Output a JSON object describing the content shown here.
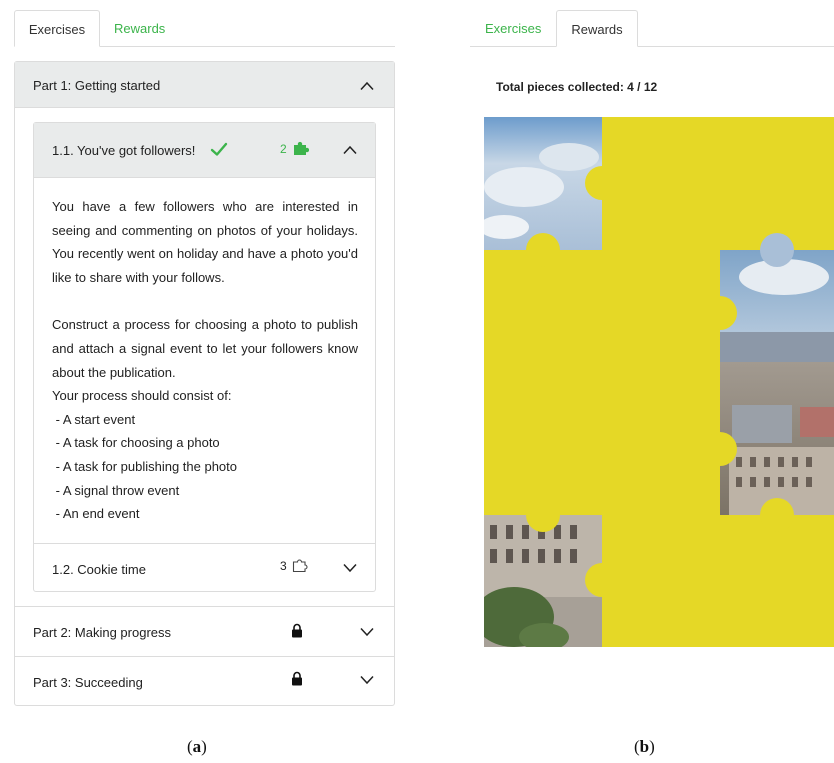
{
  "panel_a": {
    "tabs": [
      {
        "label": "Exercises",
        "active": true
      },
      {
        "label": "Rewards",
        "active": false
      }
    ],
    "parts": [
      {
        "title": "Part 1: Getting started",
        "expanded": true,
        "icon": "chevron-up-icon"
      },
      {
        "title": "Part 2: Making progress",
        "locked": true,
        "icon": "chevron-down-icon"
      },
      {
        "title": "Part 3: Succeeding",
        "locked": true,
        "icon": "chevron-down-icon"
      }
    ],
    "exercise_1": {
      "title": "1.1. You've got followers!",
      "completed_icon": "check-icon",
      "pieces": "2",
      "pieces_icon": "puzzle-piece-filled-icon",
      "paragraph_1": "You have a few followers who are interested in seeing and commenting on photos of your holidays. You recently went on holiday and have a photo you'd like to share with your follows.",
      "paragraph_2": "Construct a process for choosing a photo to publish and attach a signal event to let your followers know about the publication.",
      "intro_line": "Your process should consist of:",
      "requirements": [
        " - A start event",
        " - A task for choosing a photo",
        " - A task for publishing the photo",
        " - A signal throw event",
        " - An end event"
      ]
    },
    "exercise_2": {
      "title": "1.2. Cookie time",
      "pieces": "3",
      "pieces_icon": "puzzle-piece-outline-icon"
    },
    "caption_open": "(",
    "caption_letter": "a",
    "caption_close": ")"
  },
  "panel_b": {
    "tabs": [
      {
        "label": "Exercises",
        "active": false
      },
      {
        "label": "Rewards",
        "active": true
      }
    ],
    "total_label": "Total pieces collected: 4 / 12",
    "puzzle_cover_color": "#e5d826",
    "caption_open": "(",
    "caption_letter": "b",
    "caption_close": ")"
  },
  "colors": {
    "accent_green": "#3cb44b",
    "header_gray": "#e9ebeb",
    "border": "#dcdcdc"
  }
}
